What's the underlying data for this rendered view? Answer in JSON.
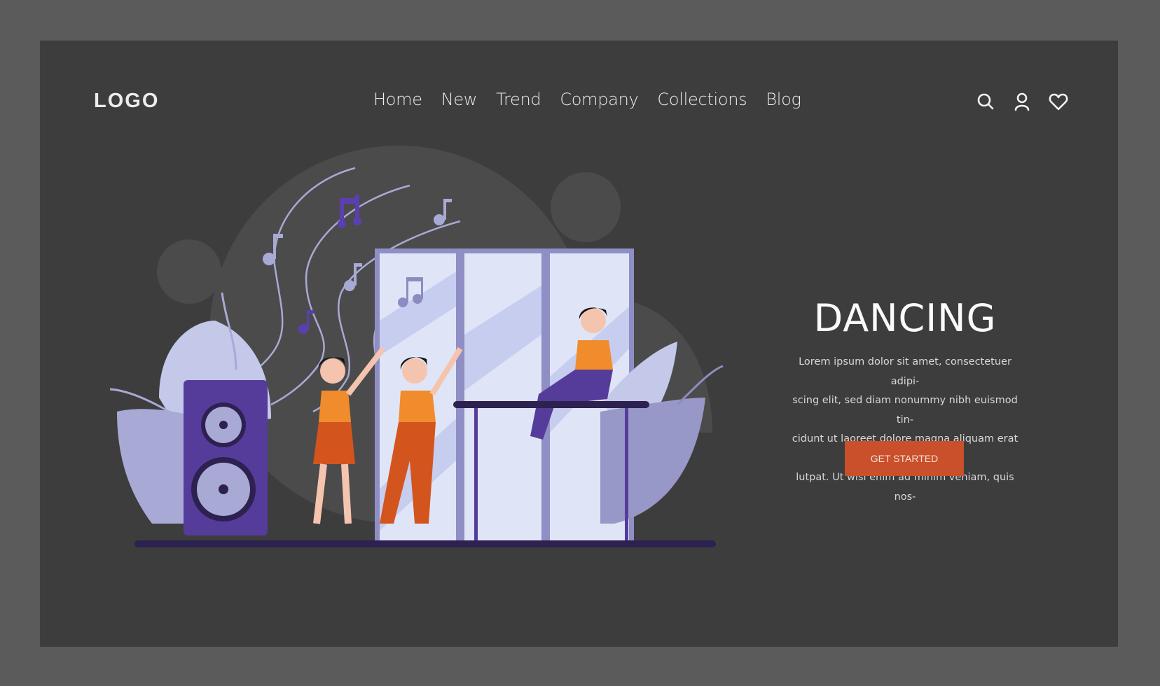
{
  "header": {
    "logo": "LOGO",
    "nav": [
      {
        "label": "Home"
      },
      {
        "label": "New"
      },
      {
        "label": "Trend"
      },
      {
        "label": "Company"
      },
      {
        "label": "Collections"
      },
      {
        "label": "Blog"
      }
    ],
    "icons": [
      "search-icon",
      "user-icon",
      "heart-icon"
    ]
  },
  "hero": {
    "title": "DANCING",
    "body": "Lorem ipsum dolor sit amet, consectetuer adipi-scing elit, sed diam nonummy nibh euismod tin-cidunt ut laoreet dolore magna aliquam erat vo-lutpat. Ut wisi enim ad minim veniam, quis nos-",
    "lines": [
      "Lorem ipsum dolor sit amet, consectetuer adipi-",
      "scing elit, sed diam nonummy nibh euismod tin-",
      "cidunt ut laoreet dolore magna aliquam erat vo-",
      "lutpat. Ut wisi enim ad minim veniam, quis nos-"
    ],
    "cta_label": "GET STARTED"
  },
  "colors": {
    "outer_bg": "#5b5b5b",
    "panel_bg": "#3d3d3d",
    "accent": "#c9502a",
    "purple": "#553c9a",
    "lavender": "#a9a9d6"
  }
}
